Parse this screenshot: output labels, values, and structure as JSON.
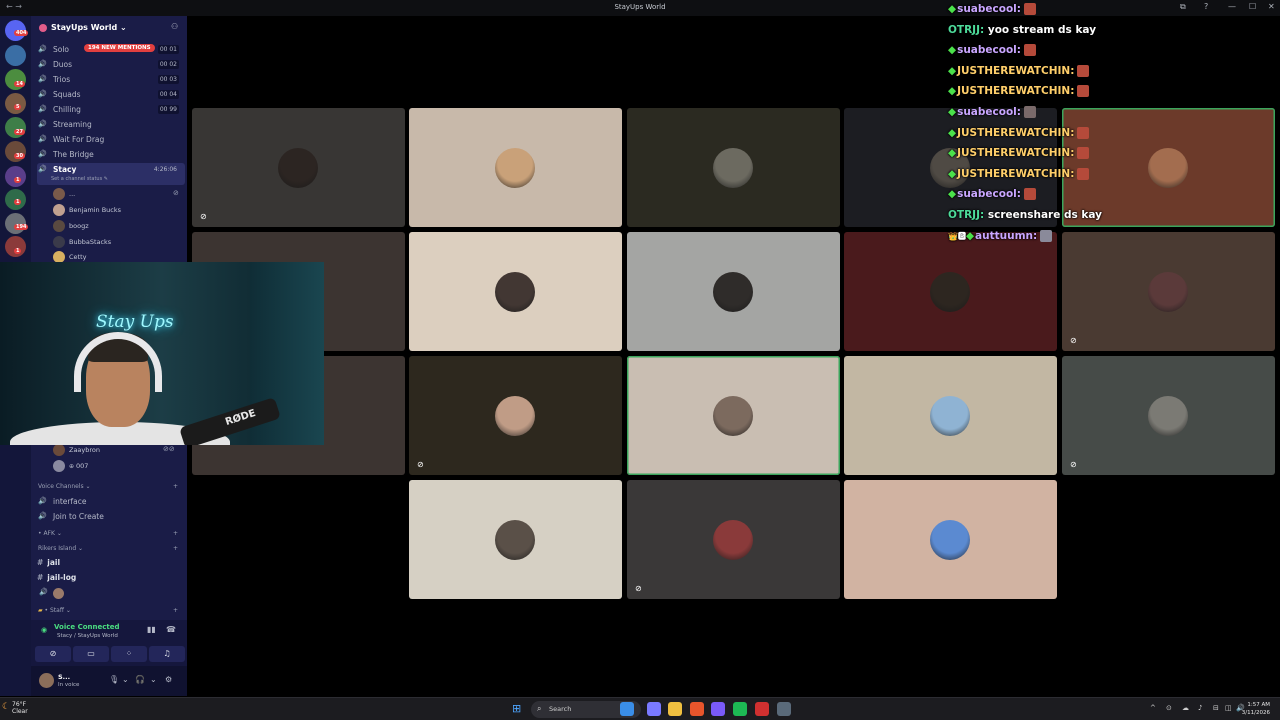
{
  "window": {
    "title": "StayUps World",
    "nav": "← →",
    "controls": [
      "⧉",
      "?",
      "—",
      "☐",
      "✕"
    ]
  },
  "rail": {
    "badges": [
      "404",
      "14",
      "5",
      "27",
      "30",
      "1",
      "1",
      "194",
      "1"
    ],
    "servers": [
      "#3a6ea5",
      "#4c8d3f",
      "#7a5a43",
      "#3e7e48",
      "#6a4a3a",
      "#5a3e8a",
      "#2f6b4a",
      "#6b6f76",
      "#8b3a3a",
      "#2a5e7a"
    ]
  },
  "guild": {
    "name": "StayUps World ⌄"
  },
  "channels": [
    {
      "name": "Solo",
      "count": "00 01",
      "mention": "194 NEW MENTIONS"
    },
    {
      "name": "Duos",
      "count": "00 02"
    },
    {
      "name": "Trios",
      "count": "00 03"
    },
    {
      "name": "Squads",
      "count": "00 04"
    },
    {
      "name": "Chilling",
      "count": "00 99"
    },
    {
      "name": "Streaming"
    },
    {
      "name": "Wait For Drag"
    },
    {
      "name": "The Bridge"
    },
    {
      "name": "Stacy",
      "count": "4:26:06",
      "status": "Set a channel status ✎"
    }
  ],
  "members": [
    "...",
    "Benjamin Bucks",
    "boogz",
    "BubbaStacks",
    "Cetty",
    "Zaaybron",
    "007"
  ],
  "sections": {
    "voice": "Voice Channels ⌄",
    "interface": "interface",
    "join": "Join to Create",
    "afk": "• AFK ⌄",
    "rikers": "Rikers Island ⌄",
    "jail": "jail",
    "jaillog": "jail-log",
    "staff": "• Staff ⌄"
  },
  "voice_panel": {
    "status": "Voice Connected",
    "location": "Stacy / StayUps World",
    "buttons": [
      "⊘",
      "▭",
      "⁘",
      "♫"
    ]
  },
  "user": {
    "name": "S...",
    "status": "In voice",
    "icons": [
      "🎙",
      "⌄",
      "🎧",
      "⌄",
      "⚙"
    ]
  },
  "webcam": {
    "neon": "Stay Ups",
    "mic_brand": "RØDE"
  },
  "tiles": [
    {
      "bg": "#383634",
      "av": "#2c2522"
    },
    {
      "bg": "#c8b9aa",
      "av": "#c9a179"
    },
    {
      "bg": "#2b2a21",
      "av": "#6c6a60"
    },
    {
      "bg": "#1c1d22",
      "av": "#4f4a44"
    },
    {
      "bg": "#6c3a2a",
      "av": "#a36d4f"
    },
    {
      "bg": "#3c3431",
      "av": "#3a302c"
    },
    {
      "bg": "#dccfbf",
      "av": "#423733"
    },
    {
      "bg": "#a4a5a3",
      "av": "#2f2c2a"
    },
    {
      "bg": "#4a1a1c",
      "av": "#2d2620"
    },
    {
      "bg": "#4a3a32",
      "av": "#5b3a3a"
    },
    {
      "bg": "#3c3431",
      "av": "#3a302c"
    },
    {
      "bg": "#2d281e",
      "av": "#c09c86"
    },
    {
      "bg": "#c9beb2",
      "av": "#7c6a5e"
    },
    {
      "bg": "#c2b7a3",
      "av": "#8fb3d3"
    },
    {
      "bg": "#464b48",
      "av": "#7b7a74"
    },
    {
      "bg": "#d6d0c4",
      "av": "#5a5048"
    },
    {
      "bg": "#3a3838",
      "av": "#8a3a3a"
    },
    {
      "bg": "#d1b3a2",
      "av": "#5b8ad1"
    }
  ],
  "chat": [
    {
      "user": "suabecool:",
      "text": "",
      "color": "#c9a6ff",
      "diamond": true,
      "emote": "#b54a3a"
    },
    {
      "user": "OTRJJ:",
      "text": "yoo stream ds kay",
      "color": "#4ddb9a",
      "diamond": false
    },
    {
      "user": "suabecool:",
      "text": "",
      "color": "#c9a6ff",
      "diamond": true,
      "emote": "#b54a3a"
    },
    {
      "user": "JUSTHEREWATCHIN:",
      "text": "",
      "color": "#ffcf6a",
      "diamond": true,
      "emote": "#b54a3a"
    },
    {
      "user": "JUSTHEREWATCHIN:",
      "text": "",
      "color": "#ffcf6a",
      "diamond": true,
      "emote": "#b54a3a"
    },
    {
      "user": "suabecool:",
      "text": "",
      "color": "#c9a6ff",
      "diamond": true,
      "emote": "#7a6a6a"
    },
    {
      "user": "JUSTHEREWATCHIN:",
      "text": "",
      "color": "#ffcf6a",
      "diamond": true,
      "emote": "#b54a3a"
    },
    {
      "user": "JUSTHEREWATCHIN:",
      "text": "",
      "color": "#ffcf6a",
      "diamond": true,
      "emote": "#b54a3a"
    },
    {
      "user": "JUSTHEREWATCHIN:",
      "text": "",
      "color": "#ffcf6a",
      "diamond": true,
      "emote": "#b54a3a"
    },
    {
      "user": "suabecool:",
      "text": "",
      "color": "#c9a6ff",
      "diamond": true,
      "emote": "#b54a3a"
    },
    {
      "user": "OTRJJ:",
      "text": "screenshare ds kay",
      "color": "#4ddb9a",
      "diamond": false
    },
    {
      "user": "auttuumn:",
      "text": "",
      "color": "#c9a6ff",
      "diamond": true,
      "emote": "#8a8a9a",
      "badges": "👑🅱"
    }
  ],
  "taskbar": {
    "temp": "76°F",
    "cond": "Clear",
    "search": "Search",
    "time": "1:57 AM",
    "date": "3/11/2026",
    "apps": [
      "#3a8ee8",
      "#7a7aff",
      "#f0c040",
      "#e8552c",
      "#7a5af8",
      "#1db954",
      "#d03030",
      "#5a6a7a"
    ],
    "tray": [
      "^",
      "⊙",
      "☁",
      "♪",
      "⊟",
      "◫",
      "🔊"
    ]
  }
}
